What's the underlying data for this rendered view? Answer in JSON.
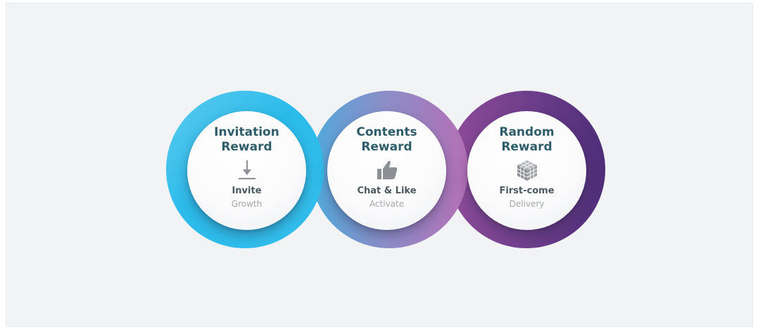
{
  "colors": {
    "background": "#f2f3f5",
    "title_text": "#2f5d6a",
    "ring_invitation": "#2bbbea",
    "ring_contents": "#8a8fc9",
    "ring_random": "#6f3f8c"
  },
  "rewards": [
    {
      "title_line1": "Invitation",
      "title_line2": "Reward",
      "icon": "down-arrow-icon",
      "label": "Invite",
      "caption": "Growth"
    },
    {
      "title_line1": "Contents",
      "title_line2": "Reward",
      "icon": "thumbs-up-icon",
      "label": "Chat & Like",
      "caption": "Activate"
    },
    {
      "title_line1": "Random",
      "title_line2": "Reward",
      "icon": "cube-grid-icon",
      "label": "First-come",
      "caption": "Delivery"
    }
  ]
}
